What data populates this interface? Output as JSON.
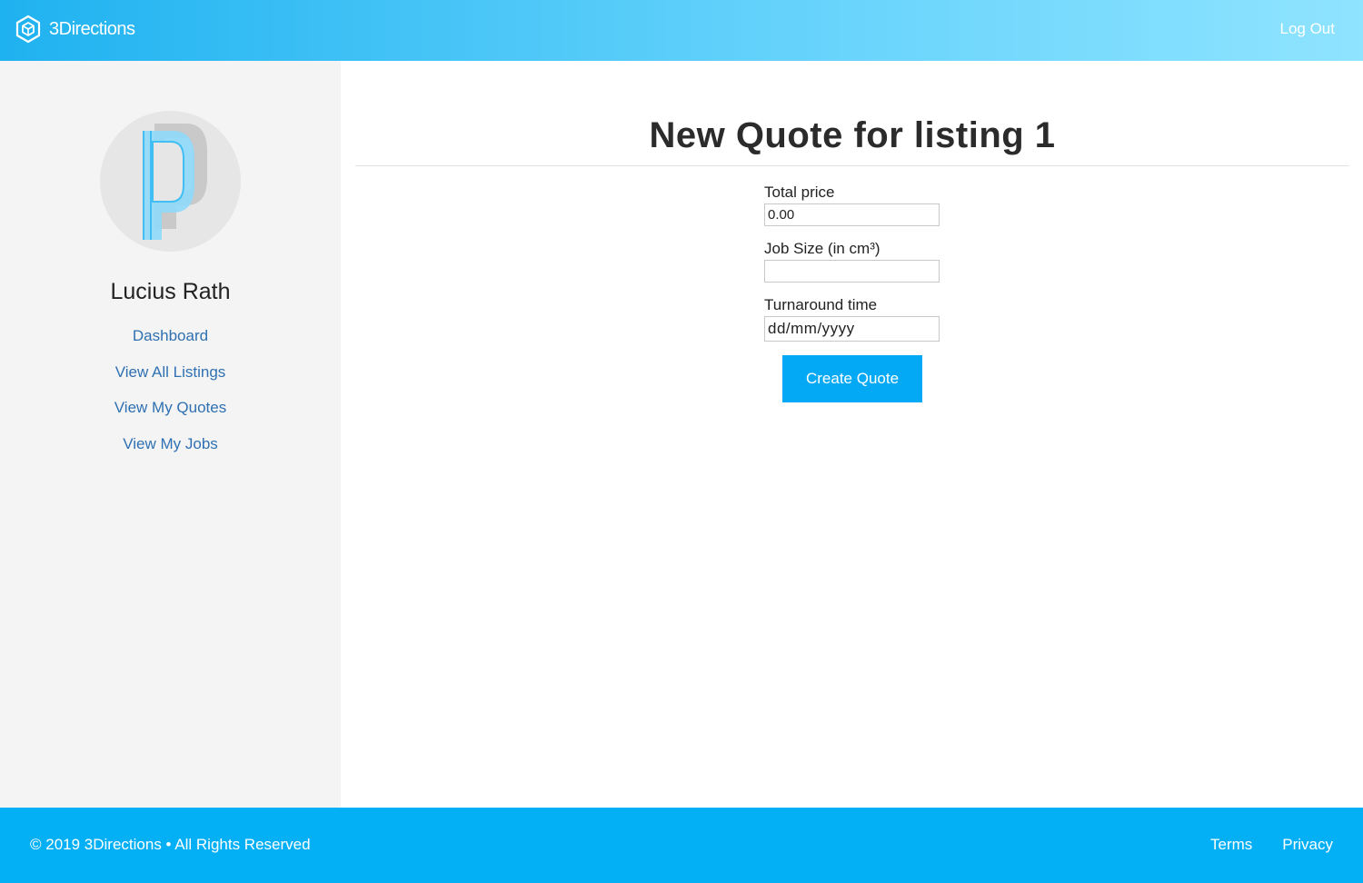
{
  "header": {
    "brand_name": "3Directions",
    "brand_icon": "cube-icon",
    "logout_label": "Log Out",
    "gradient": [
      "#1fb2f0",
      "#8fe4ff"
    ]
  },
  "sidebar": {
    "avatar_icon": "letter-p-avatar",
    "user_name": "Lucius Rath",
    "items": [
      {
        "label": "Dashboard"
      },
      {
        "label": "View All Listings"
      },
      {
        "label": "View My Quotes"
      },
      {
        "label": "View My Jobs"
      }
    ],
    "link_color": "#2f70b2"
  },
  "main": {
    "title": "New Quote for listing 1",
    "fields": {
      "total_price": {
        "label": "Total price",
        "value": "0.00"
      },
      "job_size": {
        "label": "Job Size (in cm³)",
        "value": ""
      },
      "turnaround": {
        "label": "Turnaround time",
        "placeholder": "dd/mm/yyyy"
      }
    },
    "submit_label": "Create Quote",
    "accent": "#03a9f4"
  },
  "footer": {
    "copyright": "© 2019 3Directions • All Rights Reserved",
    "links": [
      {
        "label": "Terms"
      },
      {
        "label": "Privacy"
      }
    ],
    "background": "#03aff5"
  }
}
